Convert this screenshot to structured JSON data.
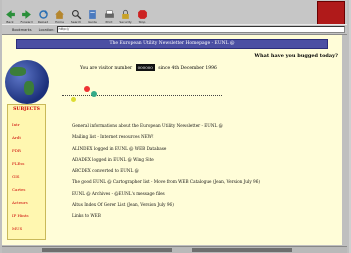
{
  "toolbar": {
    "buttons": [
      {
        "label": "Back",
        "icon": "back-arrow-icon"
      },
      {
        "label": "Forward",
        "icon": "forward-arrow-icon"
      },
      {
        "label": "Reload",
        "icon": "reload-icon"
      },
      {
        "label": "Home",
        "icon": "home-icon"
      },
      {
        "label": "Search",
        "icon": "search-icon"
      },
      {
        "label": "Guide",
        "icon": "guide-icon"
      },
      {
        "label": "Print",
        "icon": "print-icon"
      },
      {
        "label": "Security",
        "icon": "security-icon"
      },
      {
        "label": "Stop",
        "icon": "stop-icon"
      }
    ]
  },
  "location": {
    "bookmarks_label": "Bookmarks",
    "location_label": "Location:",
    "url": "http://   "
  },
  "page": {
    "banner": "The European Utility Newsletter Homepage - EUNL @",
    "tagline": "What have you bugged today?",
    "visitor_prefix": "You are visitor number",
    "visitor_suffix": "since 4th December 1996",
    "sidebar_title": "SUBJECTS",
    "sidebar_items": [
      "Intr",
      "Ardt",
      "PDR",
      "FLEss",
      "GIS",
      "Cartes",
      "Acteurs",
      "IP Hints",
      "MUS"
    ],
    "links": [
      "General informations about the European Utility Newsletter - EUNL @",
      "Mailing list - Internet resources NEW!",
      "ALINDEX logged in EUNL @ WEB Database",
      "ADADEX logged in EUNL @ Wing Site",
      "ABCDEX converted to EUNL @",
      "The good EUNL @ Cartographer list - Move from WEB Catalogue (Jean, Version July 96)",
      "EUNL @ Archives - @EUNL's message files",
      "Altus Index Of Gerer List (Jean, Version July 96)",
      "Links to WEB"
    ]
  },
  "colors": {
    "banner_bg": "#4b4fa3",
    "page_bg": "#fffdd8",
    "accent_red": "#cc0000"
  }
}
